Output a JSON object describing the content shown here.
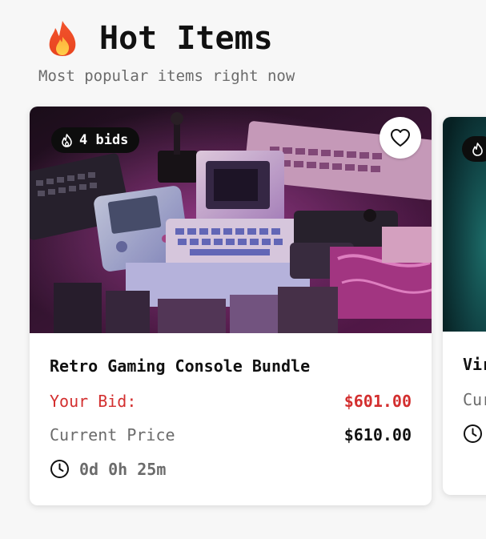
{
  "header": {
    "title": "Hot Items",
    "subtitle": "Most popular items right now",
    "icon": "fire-emoji-icon"
  },
  "cards": [
    {
      "name": "Retro Gaming Console Bundle",
      "bids": "4 bids",
      "your_bid_label": "Your Bid:",
      "your_bid_value": "$601.00",
      "current_price_label": "Current Price",
      "current_price_value": "$610.00",
      "time_left": "0d 0h 25m",
      "image": "retro-console-photo",
      "favorite_icon": "heart-outline-icon"
    },
    {
      "name": "Vir",
      "current_price_label": "Cur",
      "image": "teal-photo"
    }
  ],
  "colors": {
    "bid_red": "#d32f2f",
    "muted": "#6b6b6b",
    "pill_bg": "#0d0d0d",
    "page_bg": "#f7f7f7"
  }
}
